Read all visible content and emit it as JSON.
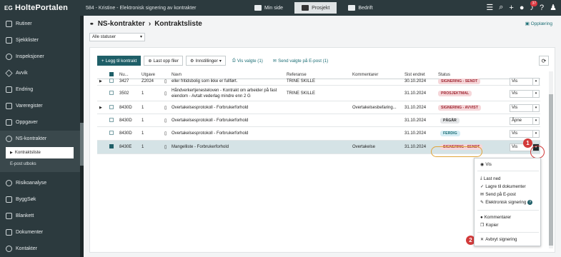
{
  "app": {
    "brand_eg": "EG",
    "brand_name": "HoltePortalen",
    "context": "584 - Kristine - Elektronisk signering av kontrakter",
    "nav": [
      "Min side",
      "Prosjekt",
      "Bedrift"
    ],
    "notification_count": "37"
  },
  "sidebar": {
    "items": [
      {
        "label": "Rutiner",
        "icon": "routines-icon"
      },
      {
        "label": "Sjekklister",
        "icon": "checklist-icon"
      },
      {
        "label": "Inspeksjoner",
        "icon": "inspection-icon"
      },
      {
        "label": "Avvik",
        "icon": "warning-icon"
      },
      {
        "label": "Endring",
        "icon": "shuffle-icon"
      },
      {
        "label": "Vareregister",
        "icon": "register-icon"
      },
      {
        "label": "Oppgaver",
        "icon": "task-icon"
      },
      {
        "label": "NS-kontrakter",
        "icon": "handshake-icon"
      },
      {
        "label": "Risikoanalyse",
        "icon": "risk-icon"
      },
      {
        "label": "ByggSøk",
        "icon": "search-build-icon"
      },
      {
        "label": "Blankett",
        "icon": "form-icon"
      },
      {
        "label": "Dokumenter",
        "icon": "document-icon"
      },
      {
        "label": "Kontakter",
        "icon": "contacts-icon"
      }
    ],
    "sub": [
      "Kontraktsliste",
      "E-post utboks"
    ]
  },
  "header": {
    "title": "NS-kontrakter",
    "subtitle": "Kontraktsliste",
    "help": "Opplæring",
    "status_filter": "Alle statuser"
  },
  "toolbar": {
    "add": "Legg til kontrakt",
    "upload": "Last opp filer",
    "settings": "Innstillinger",
    "show_selected": "Vis valgte (1)",
    "send_selected": "Send valgte på E-post (1)"
  },
  "table": {
    "columns": [
      "Nu...",
      "Utgave",
      "Navn",
      "Referanse",
      "Kommentarer",
      "Sist endret",
      "Status"
    ],
    "rows": [
      {
        "num": "3427",
        "edition": "Z2024",
        "name": "eller fritidsbolig som ikke er fullført.",
        "ref": "TRINE SKILLE",
        "comment": "",
        "date": "30.10.2024",
        "status": "SIGNERING - SENDT",
        "action": "Vis"
      },
      {
        "num": "3502",
        "edition": "1",
        "name": "Håndverkertjenesteloven - Kontrakt om arbeider på fast eiendom - Avtalt vederlag mindre enn 2 G",
        "ref": "TRINE SKILLE",
        "comment": "",
        "date": "31.10.2024",
        "status": "PROSJEKTMAL",
        "action": "Vis"
      },
      {
        "num": "8430D",
        "edition": "1",
        "name": "Overtakelsesprotokoll - Forbrukerforhold",
        "ref": "",
        "comment": "Overtakelsesbefaring...",
        "date": "31.10.2024",
        "status": "SIGNERING - AVVIST",
        "action": "Vis"
      },
      {
        "num": "8430D",
        "edition": "1",
        "name": "Overtakelsesprotokoll - Forbrukerforhold",
        "ref": "",
        "comment": "",
        "date": "31.10.2024",
        "status": "PÅGÅR",
        "action": "Åpne"
      },
      {
        "num": "8430D",
        "edition": "1",
        "name": "Overtakelsesprotokoll - Forbrukerforhold",
        "ref": "",
        "comment": "",
        "date": "31.10.2024",
        "status": "FERDIG",
        "action": "Vis"
      },
      {
        "num": "8430E",
        "edition": "1",
        "name": "Mangelliste - Forbrukerforhold",
        "ref": "",
        "comment": "Overtakelse",
        "date": "31.10.2024",
        "status": "SIGNERING - SENDT",
        "action": "Vis"
      }
    ]
  },
  "menu": {
    "items": [
      "Vis",
      "Last ned",
      "Lagre til dokumenter",
      "Send på E-post",
      "Elektronisk signering",
      "Kommentarer",
      "Kopier",
      "Avbryt signering"
    ]
  },
  "callouts": [
    "1",
    "2"
  ],
  "colors": {
    "topbar": "#2c3a3e",
    "primary": "#1f5f68",
    "highlight": "#e0a43a",
    "callout": "#d23a3a"
  }
}
